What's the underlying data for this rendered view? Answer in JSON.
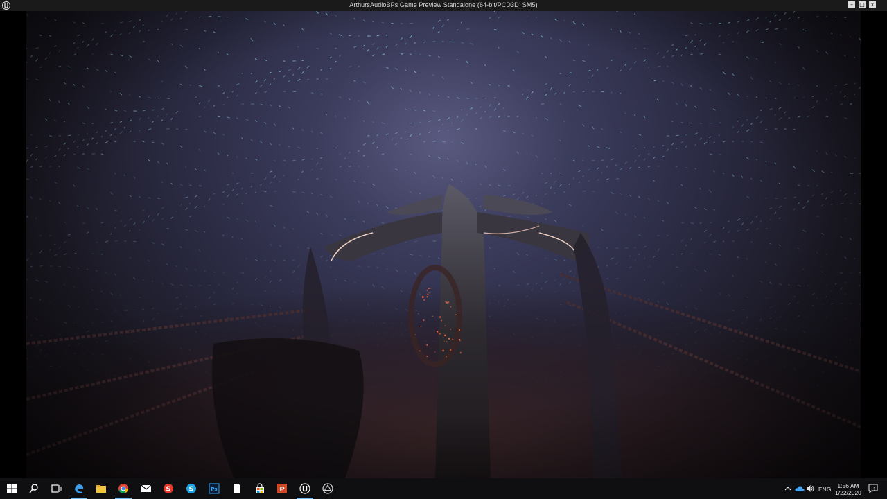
{
  "window": {
    "title": "ArthursAudioBPs Game Preview Standalone (64-bit/PCD3D_SM5)",
    "controls": {
      "minimize": "–",
      "maximize": "□",
      "close": "x"
    }
  },
  "scene": {
    "description_icon": "ue4-viewport",
    "colors": {
      "sky": "#3b3c5c",
      "particles": "#9fe6ff",
      "glow": "#ffd7c8",
      "ember": "#ff6a3d"
    }
  },
  "taskbar": {
    "items": [
      {
        "icon": "windows-start-icon"
      },
      {
        "icon": "search-icon"
      },
      {
        "icon": "task-view-icon"
      },
      {
        "icon": "edge-browser-icon"
      },
      {
        "icon": "file-explorer-icon"
      },
      {
        "icon": "chrome-icon"
      },
      {
        "icon": "mail-icon"
      },
      {
        "icon": "red-app-icon"
      },
      {
        "icon": "skype-icon"
      },
      {
        "icon": "photoshop-icon"
      },
      {
        "icon": "document-icon"
      },
      {
        "icon": "store-icon"
      },
      {
        "icon": "powerpoint-icon"
      },
      {
        "icon": "unreal-engine-icon"
      },
      {
        "icon": "unity-icon"
      }
    ],
    "tray": {
      "language": "ENG",
      "time": "1:56 AM",
      "date": "1/22/2020",
      "notification_count": "1"
    }
  }
}
